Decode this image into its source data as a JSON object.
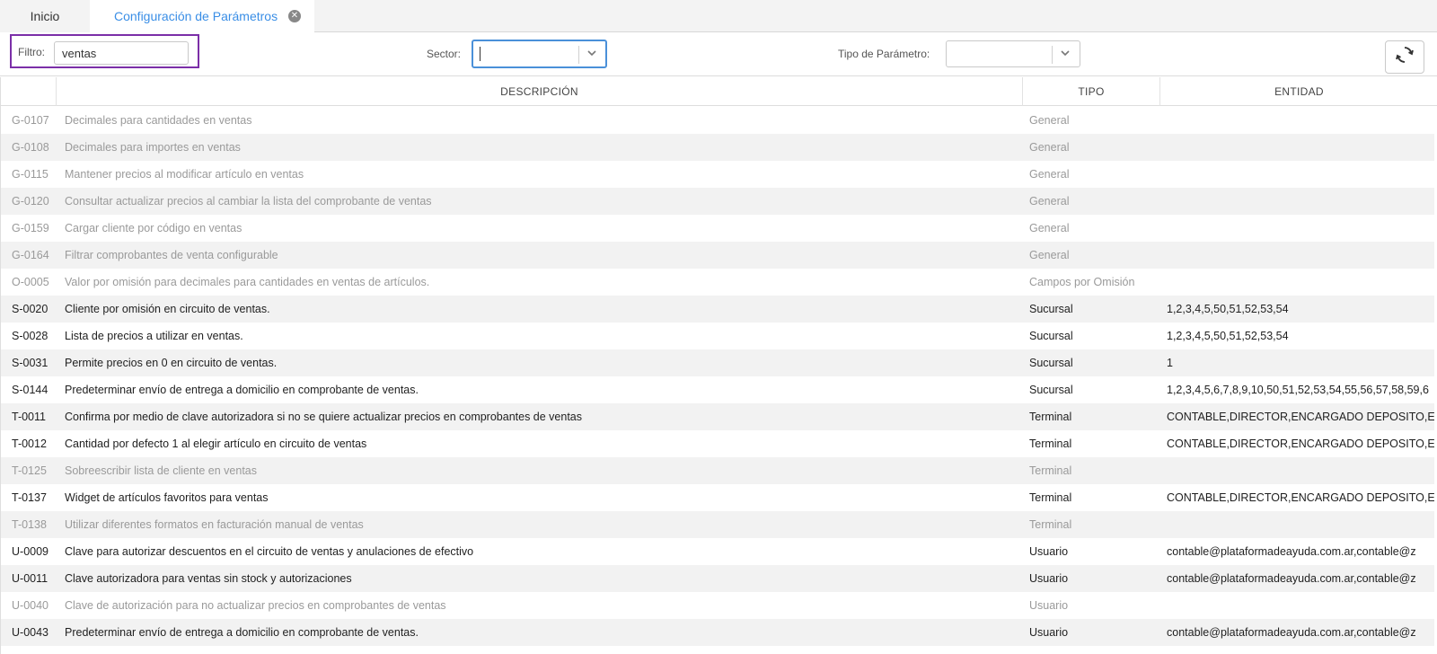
{
  "tabs": [
    {
      "label": "Inicio"
    },
    {
      "label": "Configuración de Parámetros"
    }
  ],
  "toolbar": {
    "filter_label": "Filtro:",
    "filter_value": "ventas",
    "sector_label": "Sector:",
    "sector_value": "",
    "tipo_label": "Tipo de Parámetro:",
    "tipo_value": ""
  },
  "columns": [
    "",
    "DESCRIPCIÓN",
    "TIPO",
    "ENTIDAD"
  ],
  "rows": [
    {
      "code": "G-0107",
      "desc": "Decimales para cantidades en ventas",
      "tipo": "General",
      "entidad": "",
      "active": false
    },
    {
      "code": "G-0108",
      "desc": "Decimales para importes en ventas",
      "tipo": "General",
      "entidad": "",
      "active": false
    },
    {
      "code": "G-0115",
      "desc": "Mantener precios al modificar artículo en ventas",
      "tipo": "General",
      "entidad": "",
      "active": false
    },
    {
      "code": "G-0120",
      "desc": "Consultar actualizar precios al cambiar la lista del comprobante de ventas",
      "tipo": "General",
      "entidad": "",
      "active": false
    },
    {
      "code": "G-0159",
      "desc": "Cargar cliente por código en ventas",
      "tipo": "General",
      "entidad": "",
      "active": false
    },
    {
      "code": "G-0164",
      "desc": "Filtrar comprobantes de venta configurable",
      "tipo": "General",
      "entidad": "",
      "active": false
    },
    {
      "code": "O-0005",
      "desc": "Valor por omisión para decimales para cantidades en ventas de artículos.",
      "tipo": "Campos por Omisión",
      "entidad": "",
      "active": false
    },
    {
      "code": "S-0020",
      "desc": "Cliente por omisión en circuito de ventas.",
      "tipo": "Sucursal",
      "entidad": "1,2,3,4,5,50,51,52,53,54",
      "active": true
    },
    {
      "code": "S-0028",
      "desc": "Lista de precios a utilizar en ventas.",
      "tipo": "Sucursal",
      "entidad": "1,2,3,4,5,50,51,52,53,54",
      "active": true
    },
    {
      "code": "S-0031",
      "desc": "Permite precios en 0 en circuito de ventas.",
      "tipo": "Sucursal",
      "entidad": "1",
      "active": true
    },
    {
      "code": "S-0144",
      "desc": "Predeterminar envío de entrega a domicilio en comprobante de ventas.",
      "tipo": "Sucursal",
      "entidad": "1,2,3,4,5,6,7,8,9,10,50,51,52,53,54,55,56,57,58,59,6",
      "active": true
    },
    {
      "code": "T-0011",
      "desc": "Confirma por medio de clave autorizadora si no se quiere actualizar precios en comprobantes de ventas",
      "tipo": "Terminal",
      "entidad": "CONTABLE,DIRECTOR,ENCARGADO DEPOSITO,ENC",
      "active": true
    },
    {
      "code": "T-0012",
      "desc": "Cantidad por defecto 1 al elegir artículo en circuito de ventas",
      "tipo": "Terminal",
      "entidad": "CONTABLE,DIRECTOR,ENCARGADO DEPOSITO,ENC",
      "active": true
    },
    {
      "code": "T-0125",
      "desc": "Sobreescribir lista de cliente en ventas",
      "tipo": "Terminal",
      "entidad": "",
      "active": false
    },
    {
      "code": "T-0137",
      "desc": "Widget de artículos favoritos para ventas",
      "tipo": "Terminal",
      "entidad": "CONTABLE,DIRECTOR,ENCARGADO DEPOSITO,ENC",
      "active": true
    },
    {
      "code": "T-0138",
      "desc": "Utilizar diferentes formatos en facturación manual de ventas",
      "tipo": "Terminal",
      "entidad": "",
      "active": false
    },
    {
      "code": "U-0009",
      "desc": "Clave para autorizar descuentos en el circuito de ventas y anulaciones de efectivo",
      "tipo": "Usuario",
      "entidad": "contable@plataformadeayuda.com.ar,contable@z",
      "active": true
    },
    {
      "code": "U-0011",
      "desc": "Clave autorizadora para ventas sin stock y autorizaciones",
      "tipo": "Usuario",
      "entidad": "contable@plataformadeayuda.com.ar,contable@z",
      "active": true
    },
    {
      "code": "U-0040",
      "desc": "Clave de autorización para no actualizar precios en comprobantes de ventas",
      "tipo": "Usuario",
      "entidad": "",
      "active": false
    },
    {
      "code": "U-0043",
      "desc": "Predeterminar envío de entrega a domicilio en comprobante de ventas.",
      "tipo": "Usuario",
      "entidad": "contable@plataformadeayuda.com.ar,contable@z",
      "active": true
    }
  ]
}
